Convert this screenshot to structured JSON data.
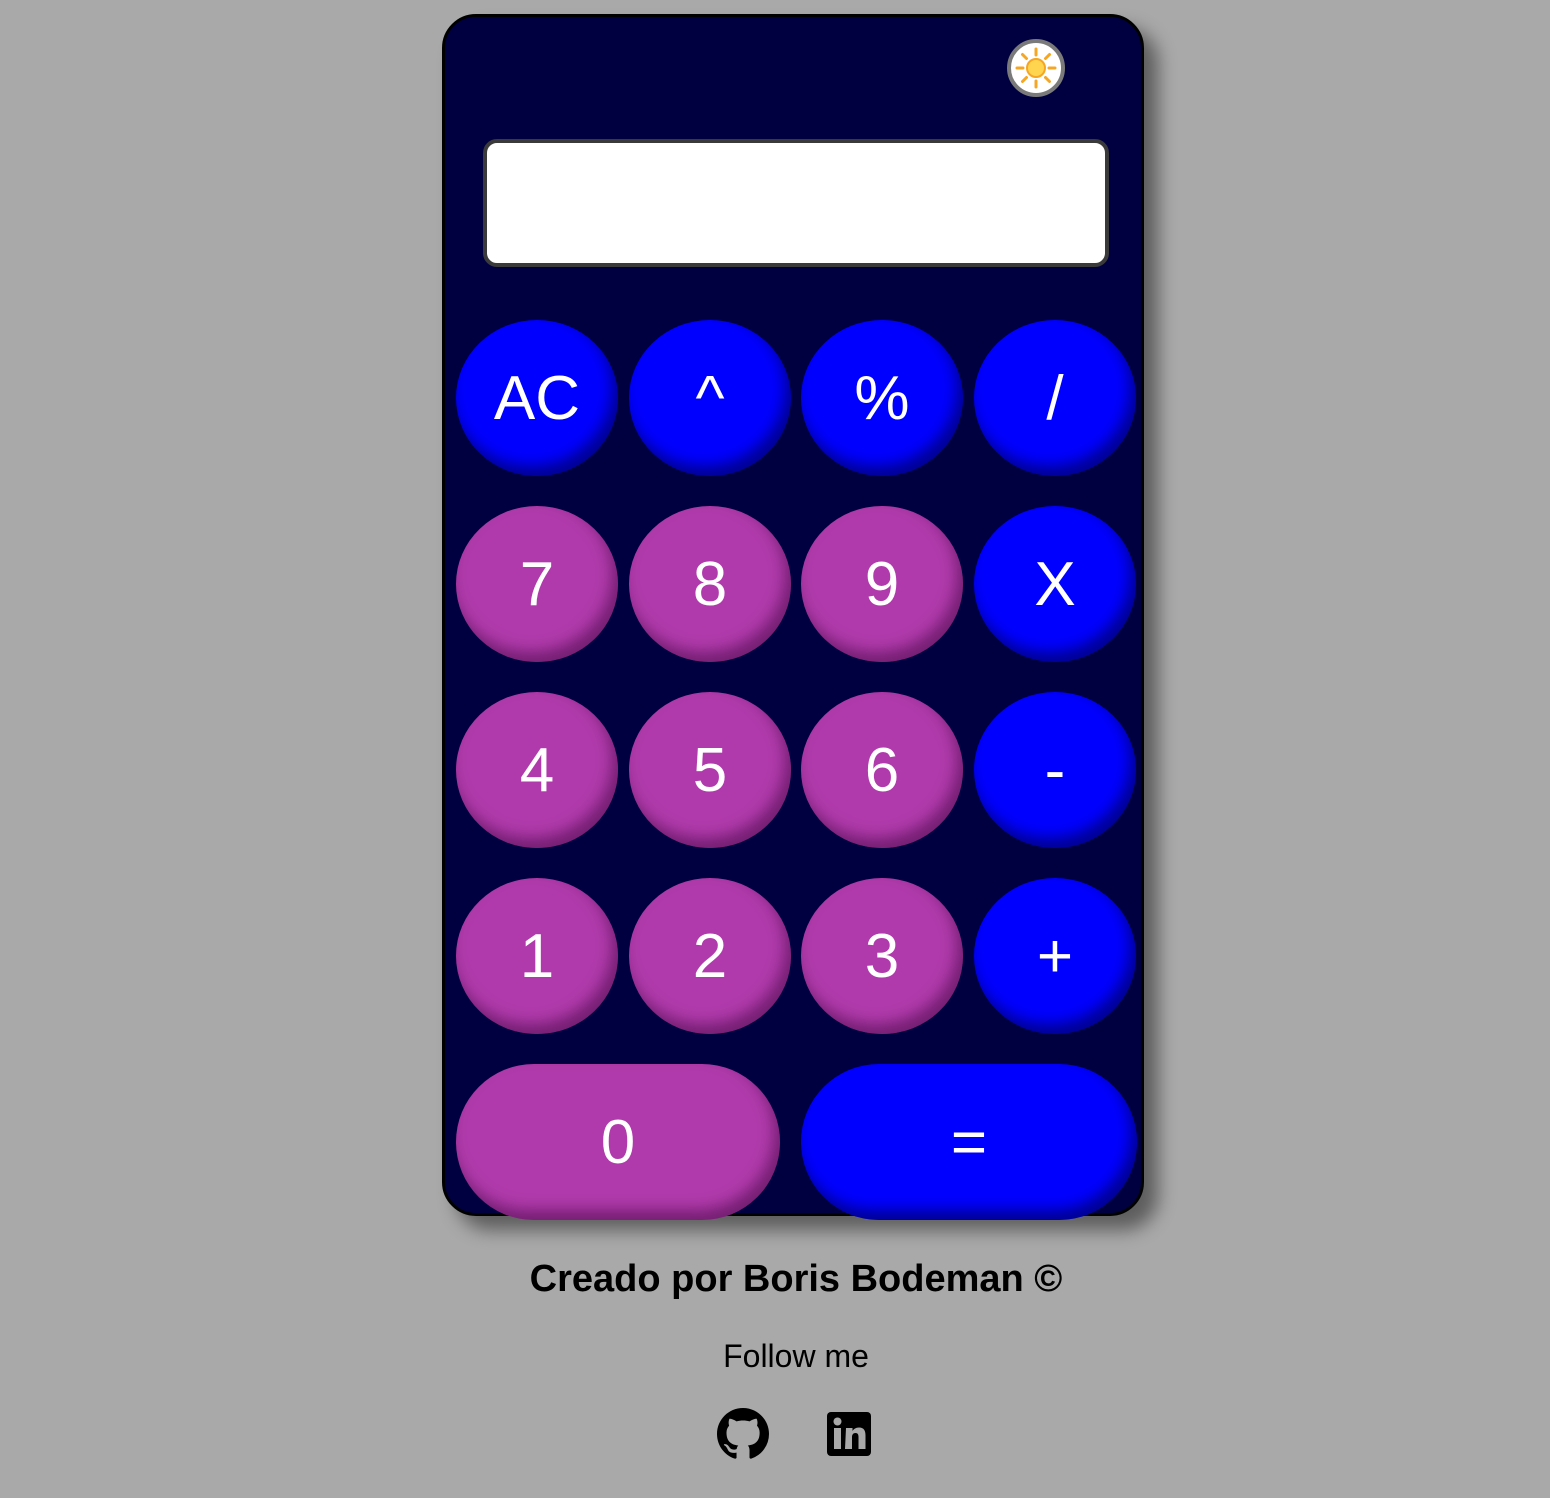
{
  "calculator": {
    "theme_toggle_icon": "sun-icon",
    "display_value": "",
    "keys": {
      "ac": "AC",
      "pow": "^",
      "percent": "%",
      "divide": "/",
      "seven": "7",
      "eight": "8",
      "nine": "9",
      "multiply": "X",
      "four": "4",
      "five": "5",
      "six": "6",
      "minus": "-",
      "one": "1",
      "two": "2",
      "three": "3",
      "plus": "+",
      "zero": "0",
      "equals": "="
    },
    "colors": {
      "body": "#000040",
      "operator": "#0000ff",
      "number": "#b03aab",
      "page_background": "#a9a9a9"
    }
  },
  "footer": {
    "credit": "Creado por Boris Bodeman ©",
    "follow": "Follow me",
    "social_icons": [
      "github-icon",
      "linkedin-icon"
    ]
  }
}
